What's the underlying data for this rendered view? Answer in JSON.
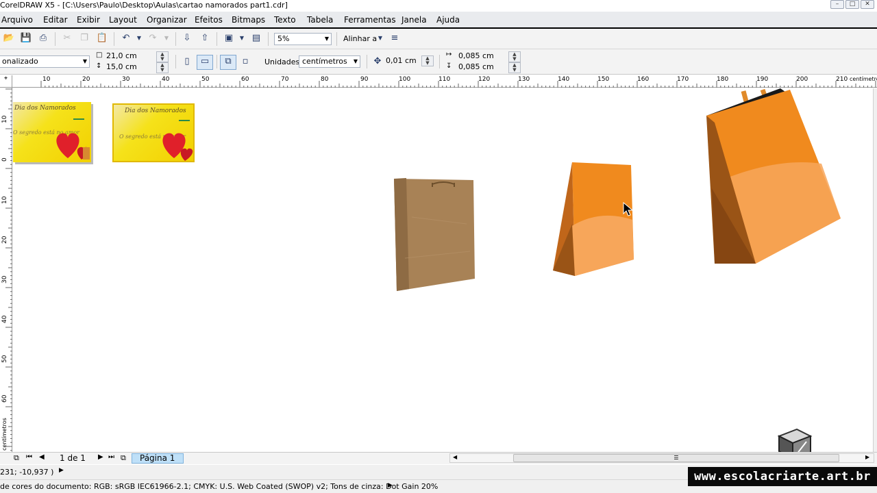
{
  "window": {
    "title": "CorelDRAW X5 - [C:\\Users\\Paulo\\Desktop\\Aulas\\cartao namorados part1.cdr]",
    "controls": [
      "–",
      "□",
      "✕"
    ]
  },
  "menu": [
    "Arquivo",
    "Editar",
    "Exibir",
    "Layout",
    "Organizar",
    "Efeitos",
    "Bitmaps",
    "Texto",
    "Tabela",
    "Ferramentas",
    "Janela",
    "Ajuda"
  ],
  "toolbar": {
    "zoom": "5%",
    "align_label": "Alinhar a"
  },
  "properties": {
    "page_preset": "onalizado",
    "width": "21,0 cm",
    "height": "15,0 cm",
    "units_label": "Unidades:",
    "units_value": "centímetros",
    "nudge": "0,01 cm",
    "dup_x": "0,085 cm",
    "dup_y": "0,085 cm"
  },
  "ruler": {
    "h_ticks": [
      "10",
      "20",
      "30",
      "40",
      "50",
      "60",
      "70",
      "80",
      "90",
      "100",
      "110",
      "120",
      "130",
      "140",
      "150",
      "160",
      "170",
      "180",
      "190",
      "200",
      "210"
    ],
    "h_unit": "centímetros",
    "v_ticks": [
      "10",
      "0",
      "10",
      "20",
      "30",
      "40",
      "50",
      "60"
    ],
    "v_unit": "centímetros"
  },
  "canvas": {
    "cards": [
      {
        "title": "Dia dos Namorados",
        "message": "O segredo está no amor"
      },
      {
        "title": "Dia dos Namorados",
        "message": "O segredo está no amor"
      }
    ],
    "colors": {
      "card_yellow": "#f5e21a",
      "bag_kraft": "#a88256",
      "bag_orange": "#f08a1e",
      "bag_orange_light": "#f7a65a",
      "bag_dark": "#9a5416",
      "heart_red": "#e0202a"
    }
  },
  "pager": {
    "count": "1 de 1",
    "page_tab": "Página 1"
  },
  "status": {
    "coords": "231; -10,937 )",
    "color_profile": "de cores do documento: RGB: sRGB IEC61966-2.1; CMYK: U.S. Web Coated (SWOP) v2; Tons de cinza: Dot Gain 20%"
  },
  "watermark": "www.escolacriarte.art.br"
}
